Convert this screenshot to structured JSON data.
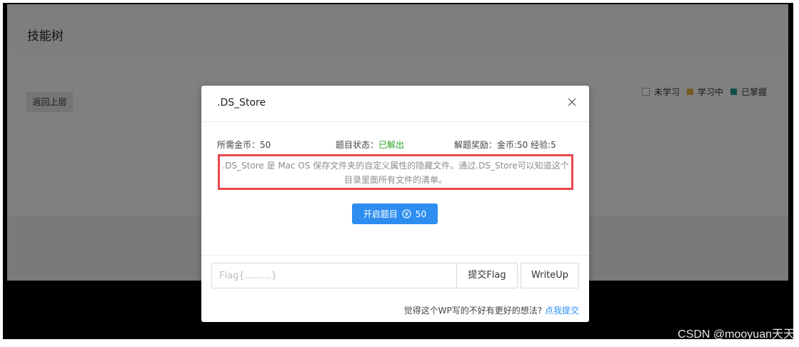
{
  "page": {
    "title": "技能树",
    "back_label": "返回上层",
    "legend": [
      {
        "label": "未学习",
        "color": "#e6e6e6"
      },
      {
        "label": "学习中",
        "color": "#d9a13a"
      },
      {
        "label": "已掌握",
        "color": "#1f8f8f"
      }
    ]
  },
  "dialog": {
    "title": ".DS_Store",
    "cost_label": "所需金币：50",
    "status_label": "题目状态：",
    "status_value": "已解出",
    "reward_label": "解题奖励：金币:50 经验:5",
    "description_line1": ".DS_Store 是 Mac OS 保存文件夹的自定义属性的隐藏文件。通过.DS_Store可以知道这个",
    "description_line2": "目录里面所有文件的清单。",
    "start_label": "开启题目",
    "start_cost": "50",
    "flag_placeholder": "Flag{.........}",
    "submit_flag_label": "提交Flag",
    "writeup_label": "WriteUp",
    "feedback_text": "觉得这个WP写的不好有更好的想法?",
    "feedback_link": "点我提交"
  },
  "colors": {
    "accent": "#2e8ef0",
    "solved": "#2aa52a",
    "highlight_border": "#e8464c"
  },
  "watermark": "CSDN @mooyuan天天"
}
